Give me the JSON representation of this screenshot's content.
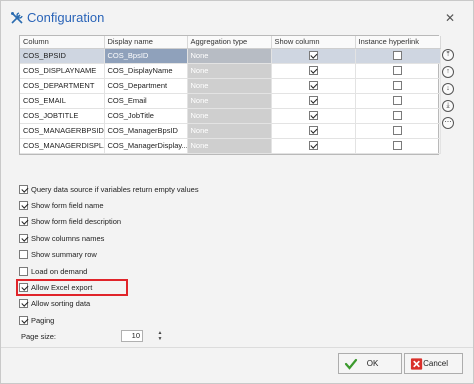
{
  "window": {
    "title": "Configuration",
    "close_glyph": "✕"
  },
  "grid": {
    "columns": [
      "Column",
      "Display name",
      "Aggregation type",
      "Show column",
      "Instance hyperlink"
    ],
    "rows": [
      {
        "column": "COS_BPSID",
        "display": "COS_BpsID",
        "agg": "None",
        "show": true,
        "link": false,
        "selected": true
      },
      {
        "column": "COS_DISPLAYNAME",
        "display": "COS_DisplayName",
        "agg": "None",
        "show": true,
        "link": false
      },
      {
        "column": "COS_DEPARTMENT",
        "display": "COS_Department",
        "agg": "None",
        "show": true,
        "link": false
      },
      {
        "column": "COS_EMAIL",
        "display": "COS_Email",
        "agg": "None",
        "show": true,
        "link": false
      },
      {
        "column": "COS_JOBTITLE",
        "display": "COS_JobTitle",
        "agg": "None",
        "show": true,
        "link": false
      },
      {
        "column": "COS_MANAGERBPSID",
        "display": "COS_ManagerBpsID",
        "agg": "None",
        "show": true,
        "link": false
      },
      {
        "column": "COS_MANAGERDISPL...",
        "display": "COS_ManagerDisplay...",
        "agg": "None",
        "show": true,
        "link": false
      }
    ]
  },
  "side_buttons": [
    "move-top-icon",
    "move-up-icon",
    "move-down-icon",
    "move-bottom-icon",
    "more-icon"
  ],
  "options": [
    {
      "label": "Query data source if variables return empty values",
      "checked": true
    },
    {
      "label": "Show form field name",
      "checked": true
    },
    {
      "label": "Show form field description",
      "checked": true
    },
    {
      "label": "Show columns names",
      "checked": true
    },
    {
      "label": "Show summary row",
      "checked": false
    },
    {
      "label": "Load on demand",
      "checked": false
    },
    {
      "label": "Allow Excel export",
      "checked": true
    },
    {
      "label": "Allow sorting data",
      "checked": true
    },
    {
      "label": "Paging",
      "checked": true
    }
  ],
  "page_size": {
    "label": "Page size:",
    "value": "10"
  },
  "buttons": {
    "ok": "OK",
    "cancel": "Cancel"
  },
  "colors": {
    "accent": "#2a64b8",
    "highlight": "#e0242a",
    "selected_row": "#8fa1bb"
  }
}
